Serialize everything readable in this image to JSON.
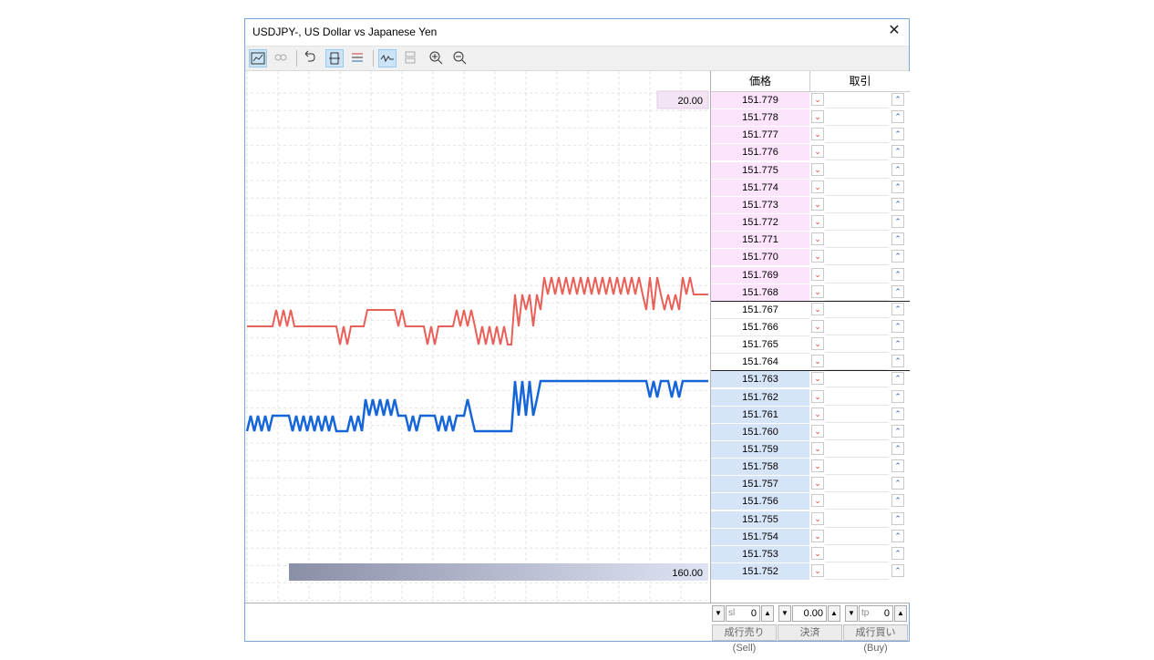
{
  "window": {
    "title": "USDJPY-, US Dollar vs Japanese Yen",
    "close_glyph": "✕"
  },
  "toolbar": {
    "buttons": [
      {
        "name": "chart-icon",
        "on": true
      },
      {
        "name": "objects-icon",
        "on": false,
        "disabled": true
      },
      {
        "name": "auto-scroll-icon",
        "on": false
      },
      {
        "name": "center-price-icon",
        "on": true
      },
      {
        "name": "levels-icon",
        "on": false
      },
      {
        "name": "tick-chart-icon",
        "on": true
      },
      {
        "name": "one-click-icon",
        "on": false,
        "disabled": true
      },
      {
        "name": "zoom-in-icon",
        "on": false
      },
      {
        "name": "zoom-out-icon",
        "on": false
      }
    ]
  },
  "chart": {
    "volume_top_label": "20.00",
    "volume_bottom_label": "160.00",
    "ask_color": "#e8605a",
    "bid_color": "#1565d8"
  },
  "dom": {
    "header_price": "価格",
    "header_trade": "取引",
    "sell_arrow": "⌄",
    "buy_arrow": "⌃",
    "ask_prices": [
      "151.779",
      "151.778",
      "151.777",
      "151.776",
      "151.775",
      "151.774",
      "151.773",
      "151.772",
      "151.771",
      "151.770",
      "151.769",
      "151.768"
    ],
    "mid_prices": [
      "151.767",
      "151.766",
      "151.765",
      "151.764"
    ],
    "bid_prices": [
      "151.763",
      "151.762",
      "151.761",
      "151.760",
      "151.759",
      "151.758",
      "151.757",
      "151.756",
      "151.755",
      "151.754",
      "151.753",
      "151.752"
    ]
  },
  "order": {
    "sl_label": "sl",
    "sl_value": "0",
    "volume_value": "0.00",
    "tp_label": "tp",
    "tp_value": "0",
    "sell_button": "成行売り(Sell)",
    "close_button": "決済",
    "buy_button": "成行買い(Buy)"
  }
}
